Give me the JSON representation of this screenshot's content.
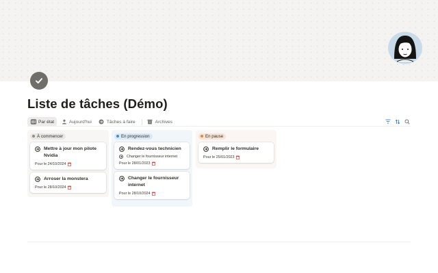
{
  "page": {
    "title": "Liste de tâches (Démo)",
    "icon": "check-circle-icon",
    "avatar": "user-avatar-illustration"
  },
  "views": {
    "tabs": [
      {
        "label": "Par état",
        "icon": "board-icon",
        "active": true
      },
      {
        "label": "Aujourd'hui",
        "icon": "person-icon",
        "active": false
      },
      {
        "label": "Tâches à faire",
        "icon": "arrow-circle-icon",
        "active": false
      },
      {
        "label": "Archives",
        "icon": "archive-icon",
        "active": false
      }
    ],
    "tools": [
      "filter-icon",
      "sort-icon",
      "search-icon"
    ]
  },
  "board": {
    "columns": [
      {
        "label": "À commencer",
        "color": "#8f8d88",
        "cards": [
          {
            "title": "Mettre à jour mon pilote Nvidia",
            "date": "Pour le 24/10/2024"
          },
          {
            "title": "Arroser la monstera",
            "date": "Pour le 28/10/2024"
          }
        ]
      },
      {
        "label": "En progression",
        "color": "#3f8bd0",
        "cards": [
          {
            "title": "Rendez-vous technicien",
            "subtask": "Changer le fournisseur internet",
            "date": "Pour le 28/01/2023"
          },
          {
            "title": "Changer le fournisseur internet",
            "date": "Pour le 28/10/2024"
          }
        ]
      },
      {
        "label": "En pause",
        "color": "#d88a4f",
        "cards": [
          {
            "title": "Remplir le formulaire",
            "date": "Pour le 25/01/2023"
          }
        ]
      }
    ]
  }
}
